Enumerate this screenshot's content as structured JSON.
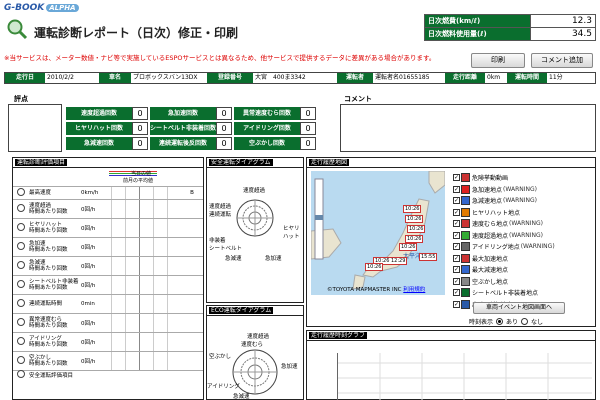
{
  "logo": {
    "brand": "G-BOOK",
    "badge": "ALPHA"
  },
  "header": {
    "title": "運転診断レポート（日次）修正・印刷",
    "notice": "※当サービスは、メーター数値・ナビ等で実施しているESPOサービスとは異なるため、他サービスで提供するデータに差異がある場合があります。"
  },
  "fuel": [
    {
      "label": "日次燃費(km/ℓ)",
      "value": "12.3"
    },
    {
      "label": "日次燃料使用量(ℓ)",
      "value": "34.5"
    }
  ],
  "toolbar": {
    "print_label": "印刷",
    "comment_label": "コメント追加"
  },
  "infobar": [
    {
      "key": "走行日",
      "value": "2010/2/2"
    },
    {
      "key": "車名",
      "value": "プロボックスバン13DX"
    },
    {
      "key": "登録番号",
      "value": "大宮　400ま3342"
    },
    {
      "key": "運転者",
      "value": "運転者名01655185"
    },
    {
      "key": "走行距離",
      "value": "0km"
    },
    {
      "key": "運転時間",
      "value": "11分"
    }
  ],
  "score": {
    "label": "評点"
  },
  "comment": {
    "label": "コメント"
  },
  "counts": [
    {
      "label": "速度超過回数",
      "value": "0"
    },
    {
      "label": "急加速回数",
      "value": "0"
    },
    {
      "label": "異常速度むら回数",
      "value": "0"
    },
    {
      "label": "ヒヤリハット回数",
      "value": "0"
    },
    {
      "label": "シートベルト非装着回数",
      "value": "0"
    },
    {
      "label": "アイドリング回数",
      "value": "0"
    },
    {
      "label": "急減速回数",
      "value": "0"
    },
    {
      "label": "連続運転後反回数",
      "value": "0"
    },
    {
      "label": "空ぶかし回数",
      "value": "0"
    }
  ],
  "eval": {
    "header": "運転診断評価項目",
    "legend_today": "当日の値",
    "legend_avg": "前月の平均値",
    "rows": [
      {
        "name": "最高速度",
        "value": "0km/h",
        "grade": "B"
      },
      {
        "name": "速度超過\n時間あたり回数",
        "value": "0回/h",
        "grade": ""
      },
      {
        "name": "ヒヤリハット\n時間あたり回数",
        "value": "0回/h",
        "grade": ""
      },
      {
        "name": "急加速\n時間あたり回数",
        "value": "0回/h",
        "grade": ""
      },
      {
        "name": "急減速\n時間あたり回数",
        "value": "0回/h",
        "grade": ""
      },
      {
        "name": "シートベルト非装着\n時間あたり回数",
        "value": "0回/h",
        "grade": ""
      },
      {
        "name": "連続運転時間",
        "value": "0min",
        "grade": ""
      },
      {
        "name": "異常速度むら\n時間あたり回数",
        "value": "0回/h",
        "grade": ""
      },
      {
        "name": "アイドリング\n時間あたり回数",
        "value": "0回/h",
        "grade": ""
      },
      {
        "name": "空ぶかし\n時間あたり回数",
        "value": "0回/h",
        "grade": ""
      }
    ],
    "footer": "安全運転評価項目"
  },
  "safety": {
    "header": "安全運転ダイアグラム",
    "labels": {
      "top": "速度超過",
      "left1": "速度超過\n連続運転",
      "left2": "非装着\nシートベルト",
      "right": "ヒヤリ\nハット",
      "bl": "急減速",
      "br": "急加速"
    }
  },
  "eco": {
    "header": "ECO運転ダイアグラム",
    "labels": {
      "top": "速度超過",
      "left1": "空ぶかし",
      "left2": "アイドリング",
      "right": "急加速",
      "bl": "急減速",
      "mid": "速度むら"
    }
  },
  "map": {
    "header": "走行履歴地図",
    "copyright": "©TOYOTA MAPMASTER INC",
    "terms": "利用規約",
    "sea": "太平洋",
    "markers": [
      "10:26",
      "10:26",
      "10:26",
      "10:26",
      "10:26",
      "10:26 12:29",
      "10:26",
      "15:55"
    ],
    "legend": [
      {
        "label": "危険挙動動画",
        "checked": true
      },
      {
        "label": "急加速地点",
        "warning": "(WARNING)",
        "checked": true
      },
      {
        "label": "急減速地点",
        "warning": "(WARNING)",
        "checked": true
      },
      {
        "label": "ヒヤリハット地点",
        "warning": "",
        "checked": true
      },
      {
        "label": "速度むら地点",
        "warning": "(WARNING)",
        "checked": true
      },
      {
        "label": "速度超過地点",
        "warning": "(WARNING)",
        "checked": true
      },
      {
        "label": "アイドリング地点",
        "warning": "(WARNING)",
        "checked": true
      },
      {
        "label": "最大加速地点",
        "warning": "",
        "checked": true
      },
      {
        "label": "最大減速地点",
        "warning": "",
        "checked": true
      },
      {
        "label": "空ぶかし地点",
        "warning": "",
        "checked": true
      },
      {
        "label": "シートベルト非装着地点",
        "warning": "",
        "checked": true
      },
      {
        "label": "出発(到着)地点",
        "warning": "",
        "checked": true
      }
    ],
    "vehicle_btn": "車両イベント地図画面へ",
    "time_label": "時刻表示",
    "time_on": "あり",
    "time_off": "なし"
  },
  "graph": {
    "header": "走行履歴時刻グラフ"
  }
}
